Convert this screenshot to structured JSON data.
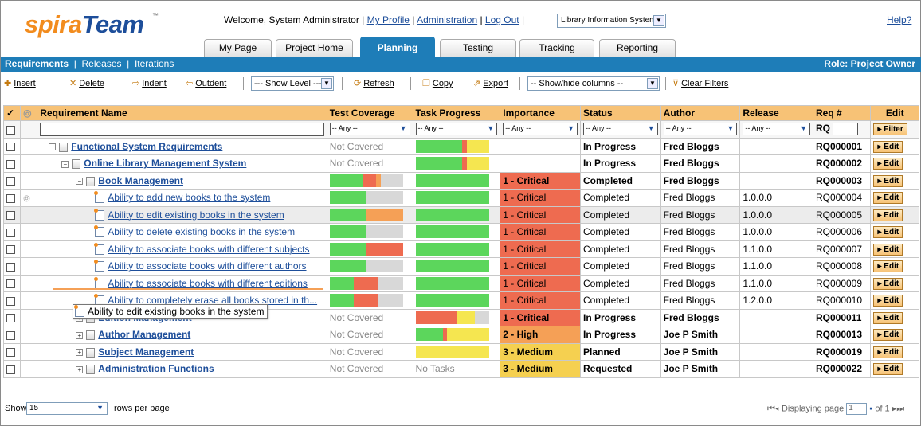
{
  "header": {
    "logo_part1": "spira",
    "logo_part2": "Team",
    "welcome": "Welcome, System Administrator |",
    "links": [
      "My Profile",
      "Administration",
      "Log Out"
    ],
    "project": "Library Information System",
    "help": "Help?"
  },
  "tabs": [
    "My Page",
    "Project Home",
    "Planning",
    "Testing",
    "Tracking",
    "Reporting"
  ],
  "active_tab": "Planning",
  "subnav": {
    "items": [
      "Requirements",
      "Releases",
      "Iterations"
    ],
    "role": "Role: Project Owner"
  },
  "toolbar": {
    "insert": "Insert",
    "delete": "Delete",
    "indent": "Indent",
    "outdent": "Outdent",
    "show_level": "--- Show Level ---",
    "refresh": "Refresh",
    "copy": "Copy",
    "export": "Export",
    "show_hide": "-- Show/hide columns --",
    "clear_filters": "Clear Filters"
  },
  "columns": [
    "Requirement Name",
    "Test Coverage",
    "Task Progress",
    "Importance",
    "Status",
    "Author",
    "Release",
    "Req #",
    "Edit"
  ],
  "filters": {
    "any": "-- Any --",
    "rq_prefix": "RQ",
    "filter_btn": "Filter"
  },
  "rows": [
    {
      "name": "Functional System Requirements",
      "level": 1,
      "type": "folder",
      "expand": "−",
      "coverage": "Not Covered",
      "task": [
        [
          0,
          58,
          "#5cd65c"
        ],
        [
          58,
          64,
          "#ee6b50"
        ],
        [
          64,
          92,
          "#f5e650"
        ]
      ],
      "importance": "",
      "imp_class": "",
      "status": "In Progress",
      "author": "Fred Bloggs",
      "release": "",
      "req": "RQ000001",
      "bold": true
    },
    {
      "name": "Online Library Management System",
      "level": 2,
      "type": "folder",
      "expand": "−",
      "coverage": "Not Covered",
      "task": [
        [
          0,
          58,
          "#5cd65c"
        ],
        [
          58,
          64,
          "#ee6b50"
        ],
        [
          64,
          92,
          "#f5e650"
        ]
      ],
      "importance": "",
      "imp_class": "",
      "status": "In Progress",
      "author": "Fred Bloggs",
      "release": "",
      "req": "RQ000002",
      "bold": true
    },
    {
      "name": "Book Management",
      "level": 3,
      "type": "folder",
      "expand": "−",
      "coverage": "",
      "cov": [
        [
          0,
          42,
          "#5cd65c"
        ],
        [
          42,
          58,
          "#ee6b50"
        ],
        [
          58,
          64,
          "#f5a056"
        ]
      ],
      "task": [
        [
          0,
          92,
          "#5cd65c"
        ]
      ],
      "importance": "1 - Critical",
      "imp_class": "crit",
      "status": "Completed",
      "author": "Fred Bloggs",
      "release": "",
      "req": "RQ000003",
      "bold": true
    },
    {
      "name": "Ability to add new books to the system",
      "level": 4,
      "type": "req",
      "coverage": "",
      "cov": [
        [
          0,
          46,
          "#5cd65c"
        ]
      ],
      "task": [
        [
          0,
          92,
          "#5cd65c"
        ]
      ],
      "importance": "1 - Critical",
      "imp_class": "crit",
      "status": "Completed",
      "author": "Fred Bloggs",
      "release": "1.0.0.0",
      "req": "RQ000004",
      "bold": false,
      "attach": true
    },
    {
      "name": "Ability to edit existing books in the system",
      "level": 4,
      "type": "req",
      "coverage": "",
      "cov": [
        [
          0,
          46,
          "#5cd65c"
        ],
        [
          46,
          92,
          "#f5a056"
        ]
      ],
      "task": [
        [
          0,
          92,
          "#5cd65c"
        ]
      ],
      "importance": "1 - Critical",
      "imp_class": "crit",
      "status": "Completed",
      "author": "Fred Bloggs",
      "release": "1.0.0.0",
      "req": "RQ000005",
      "bold": false,
      "hl": true
    },
    {
      "name": "Ability to delete existing books in the system",
      "level": 4,
      "type": "req",
      "coverage": "",
      "cov": [
        [
          0,
          46,
          "#5cd65c"
        ]
      ],
      "task": [
        [
          0,
          92,
          "#5cd65c"
        ]
      ],
      "importance": "1 - Critical",
      "imp_class": "crit",
      "status": "Completed",
      "author": "Fred Bloggs",
      "release": "1.0.0.0",
      "req": "RQ000006",
      "bold": false
    },
    {
      "name": "Ability to associate books with different subjects",
      "level": 4,
      "type": "req",
      "coverage": "",
      "cov": [
        [
          0,
          46,
          "#5cd65c"
        ],
        [
          46,
          92,
          "#ee6b50"
        ]
      ],
      "task": [
        [
          0,
          92,
          "#5cd65c"
        ]
      ],
      "importance": "1 - Critical",
      "imp_class": "crit",
      "status": "Completed",
      "author": "Fred Bloggs",
      "release": "1.1.0.0",
      "req": "RQ000007",
      "bold": false
    },
    {
      "name": "Ability to associate books with different authors",
      "level": 4,
      "type": "req",
      "coverage": "",
      "cov": [
        [
          0,
          46,
          "#5cd65c"
        ]
      ],
      "task": [
        [
          0,
          92,
          "#5cd65c"
        ]
      ],
      "importance": "1 - Critical",
      "imp_class": "crit",
      "status": "Completed",
      "author": "Fred Bloggs",
      "release": "1.1.0.0",
      "req": "RQ000008",
      "bold": false
    },
    {
      "name": "Ability to associate books with different editions",
      "level": 4,
      "type": "req",
      "coverage": "",
      "cov": [
        [
          0,
          30,
          "#5cd65c"
        ],
        [
          30,
          60,
          "#ee6b50"
        ]
      ],
      "task": [
        [
          0,
          92,
          "#5cd65c"
        ]
      ],
      "importance": "1 - Critical",
      "imp_class": "crit",
      "status": "Completed",
      "author": "Fred Bloggs",
      "release": "1.1.0.0",
      "req": "RQ000009",
      "bold": false
    },
    {
      "name": "Ability to completely erase all books stored in th...",
      "level": 4,
      "type": "req",
      "coverage": "",
      "cov": [
        [
          0,
          30,
          "#5cd65c"
        ],
        [
          30,
          60,
          "#ee6b50"
        ]
      ],
      "task": [
        [
          0,
          92,
          "#5cd65c"
        ]
      ],
      "importance": "1 - Critical",
      "imp_class": "crit",
      "status": "Completed",
      "author": "Fred Bloggs",
      "release": "1.2.0.0",
      "req": "RQ000010",
      "bold": false
    },
    {
      "name": "Edition Management",
      "level": 3,
      "type": "folder",
      "expand": "+",
      "coverage": "Not Covered",
      "task": [
        [
          0,
          52,
          "#ee6b50"
        ],
        [
          52,
          74,
          "#f5e650"
        ]
      ],
      "importance": "1 - Critical",
      "imp_class": "crit",
      "status": "In Progress",
      "author": "Fred Bloggs",
      "release": "",
      "req": "RQ000011",
      "bold": true
    },
    {
      "name": "Author Management",
      "level": 3,
      "type": "folder",
      "expand": "+",
      "coverage": "Not Covered",
      "task": [
        [
          0,
          34,
          "#5cd65c"
        ],
        [
          34,
          39,
          "#ee6b50"
        ],
        [
          39,
          92,
          "#f5e650"
        ]
      ],
      "importance": "2 - High",
      "imp_class": "high",
      "status": "In Progress",
      "author": "Joe P Smith",
      "release": "",
      "req": "RQ000013",
      "bold": true
    },
    {
      "name": "Subject Management",
      "level": 3,
      "type": "folder",
      "expand": "+",
      "coverage": "Not Covered",
      "task": [
        [
          0,
          92,
          "#f5e650"
        ]
      ],
      "importance": "3 - Medium",
      "imp_class": "med",
      "status": "Planned",
      "author": "Joe P Smith",
      "release": "",
      "req": "RQ000019",
      "bold": true
    },
    {
      "name": "Administration Functions",
      "level": 3,
      "type": "folder",
      "expand": "+",
      "coverage": "Not Covered",
      "task_text": "No Tasks",
      "importance": "3 - Medium",
      "imp_class": "med",
      "status": "Requested",
      "author": "Joe P Smith",
      "release": "",
      "req": "RQ000022",
      "bold": true
    }
  ],
  "edit_label": "Edit",
  "tooltip": "Ability to edit existing books in the system",
  "footer": {
    "show": "Show",
    "rows_value": "15",
    "rows_per_page": "rows per page",
    "displaying": "Displaying page",
    "page": "1",
    "of": "of 1"
  }
}
